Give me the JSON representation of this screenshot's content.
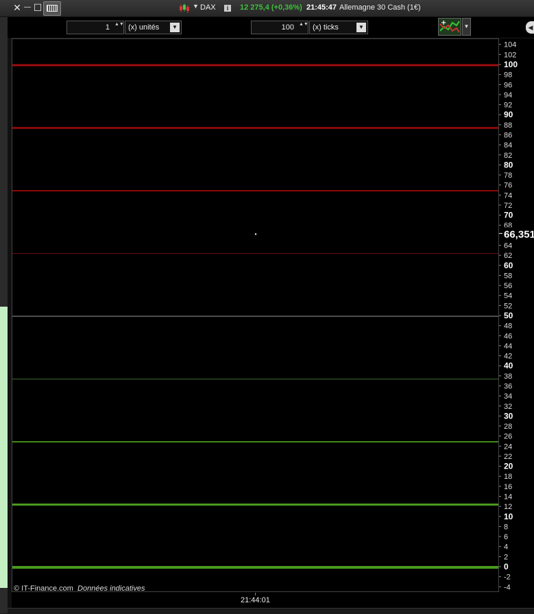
{
  "titlebar": {
    "close_glyph": "✕",
    "minimize_glyph": "—",
    "maximize_glyph": "☐",
    "keyboard_icon": "keyboard-icon",
    "dropdown_glyph": "▼",
    "ticker": "DAX",
    "info_glyph": "i",
    "price": "12 275,4 (+0,36%)",
    "time": "21:45:47",
    "instrument": "Allemagne 30 Cash (1€)"
  },
  "toolbar": {
    "units_value": "1",
    "units_label": "(x) unités",
    "ticks_value": "100",
    "ticks_label": "(x) ticks",
    "spin_glyph": "▲▼",
    "dropdown_glyph": "▼",
    "collapse_glyph": "◀"
  },
  "chart": {
    "current_value_label": "66,351",
    "copyright": "© IT-Finance.com",
    "disclaimer": "Données indicatives",
    "x_tick_label": "21:44:01"
  },
  "colors": {
    "price_up": "#3ec13e",
    "red_line": "#a00c0c",
    "green_line": "#3f8c1a",
    "neutral_line": "#9a9a9a"
  },
  "chart_data": {
    "type": "line",
    "title": "",
    "xlabel": "",
    "ylabel": "",
    "ylim": [
      -5,
      105
    ],
    "y_ticks": [
      104,
      102,
      100,
      98,
      96,
      94,
      92,
      90,
      88,
      86,
      84,
      82,
      80,
      78,
      76,
      74,
      72,
      70,
      68,
      66,
      64,
      62,
      60,
      58,
      56,
      54,
      52,
      50,
      48,
      46,
      44,
      42,
      40,
      38,
      36,
      34,
      32,
      30,
      28,
      26,
      24,
      22,
      20,
      18,
      16,
      14,
      12,
      10,
      8,
      6,
      4,
      2,
      0,
      -2,
      -4
    ],
    "bold_ticks": [
      100,
      90,
      80,
      70,
      60,
      50,
      40,
      30,
      20,
      10,
      0
    ],
    "hidden_ticks": [
      66
    ],
    "levels": [
      {
        "value": 100,
        "color": "#a00c0c",
        "weight": 3
      },
      {
        "value": 87.5,
        "color": "#a00c0c",
        "weight": 2.5
      },
      {
        "value": 75,
        "color": "#8c0a0a",
        "weight": 2
      },
      {
        "value": 62.5,
        "color": "#6e0a0a",
        "weight": 1
      },
      {
        "value": 50,
        "color": "#9a9a9a",
        "weight": 1
      },
      {
        "value": 37.5,
        "color": "#3a6a2a",
        "weight": 1
      },
      {
        "value": 25,
        "color": "#3f8c1a",
        "weight": 2
      },
      {
        "value": 12.5,
        "color": "#4a9a1e",
        "weight": 3
      },
      {
        "value": 0,
        "color": "#4a9a1e",
        "weight": 4
      }
    ],
    "points": [
      {
        "x": "21:44:01",
        "y": 66.351
      }
    ],
    "current_value": 66.351
  }
}
